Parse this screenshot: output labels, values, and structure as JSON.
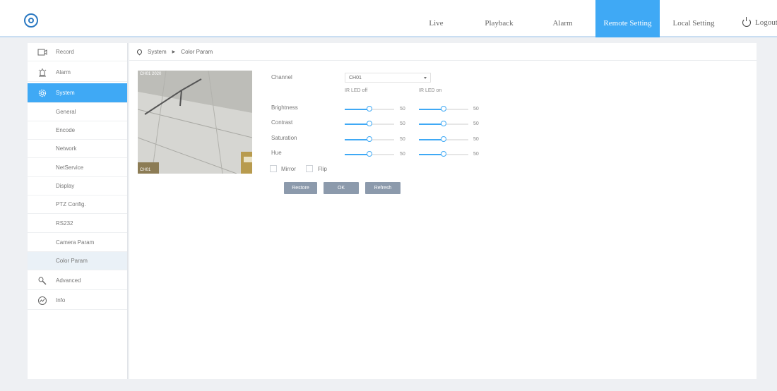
{
  "nav": {
    "items": [
      {
        "label": "Live",
        "active": false
      },
      {
        "label": "Playback",
        "active": false
      },
      {
        "label": "Alarm",
        "active": false
      },
      {
        "label": "Remote Setting",
        "active": true
      },
      {
        "label": "Local Setting",
        "active": false
      }
    ],
    "logout": "Logout"
  },
  "sidebar": {
    "items": [
      {
        "label": "Record",
        "icon": "record-icon"
      },
      {
        "label": "Alarm",
        "icon": "alarm-icon"
      },
      {
        "label": "System",
        "icon": "system-gear-icon"
      },
      {
        "label": "General"
      },
      {
        "label": "Encode"
      },
      {
        "label": "Network"
      },
      {
        "label": "NetService"
      },
      {
        "label": "Display"
      },
      {
        "label": "PTZ Config."
      },
      {
        "label": "RS232"
      },
      {
        "label": "Camera Param"
      },
      {
        "label": "Color Param"
      },
      {
        "label": "Advanced",
        "icon": "wrench-icon"
      },
      {
        "label": "Info",
        "icon": "info-chart-icon"
      }
    ]
  },
  "breadcrumb": {
    "section": "System",
    "page": "Color Param"
  },
  "preview": {
    "osd_top": "CH01 2020",
    "osd_bottom": "CH01"
  },
  "form": {
    "channel_label": "Channel",
    "channel_value": "CH01",
    "col_off": "IR LED off",
    "col_on": "IR LED on",
    "rows": [
      {
        "label": "Brightness",
        "off": 50,
        "on": 50
      },
      {
        "label": "Contrast",
        "off": 50,
        "on": 50
      },
      {
        "label": "Saturation",
        "off": 50,
        "on": 50
      },
      {
        "label": "Hue",
        "off": 50,
        "on": 50
      }
    ],
    "mirror_label": "Mirror",
    "flip_label": "Flip"
  },
  "buttons": {
    "restore": "Restore",
    "ok": "OK",
    "refresh": "Refresh"
  },
  "colors": {
    "accent": "#3fa9f5",
    "button": "#8c9aac"
  }
}
